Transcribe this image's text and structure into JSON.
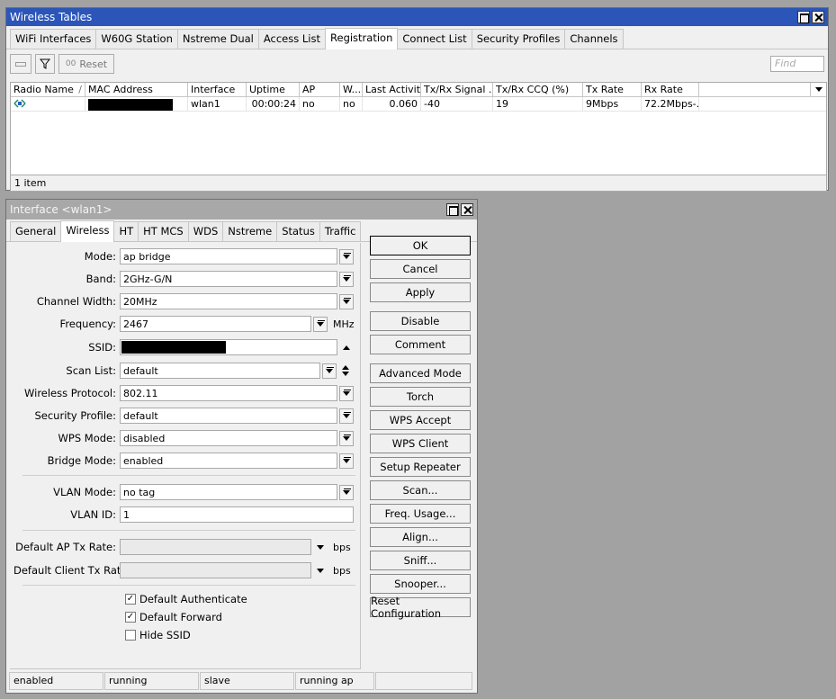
{
  "wt": {
    "title": "Wireless Tables",
    "tabs": [
      "WiFi Interfaces",
      "W60G Station",
      "Nstreme Dual",
      "Access List",
      "Registration",
      "Connect List",
      "Security Profiles",
      "Channels"
    ],
    "reset_label": "Reset",
    "find_placeholder": "Find",
    "columns": [
      "Radio Name",
      "MAC Address",
      "Interface",
      "Uptime",
      "AP",
      "W...",
      "Last Activit...",
      "Tx/Rx Signal ...",
      "Tx/Rx CCQ (%)",
      "Tx Rate",
      "Rx Rate"
    ],
    "row": {
      "interface": "wlan1",
      "uptime": "00:00:24",
      "ap": "no",
      "w": "no",
      "last": "0.060",
      "signal": "-40",
      "ccq": "19",
      "tx": "9Mbps",
      "rx": "72.2Mbps-..."
    },
    "count": "1 item"
  },
  "iw": {
    "title": "Interface <wlan1>",
    "tabs": [
      "General",
      "Wireless",
      "HT",
      "HT MCS",
      "WDS",
      "Nstreme",
      "Status",
      "Traffic"
    ],
    "labels": {
      "mode": "Mode:",
      "band": "Band:",
      "chw": "Channel Width:",
      "freq": "Frequency:",
      "ssid": "SSID:",
      "scan": "Scan List:",
      "proto": "Wireless Protocol:",
      "sec": "Security Profile:",
      "wps": "WPS Mode:",
      "bridge": "Bridge Mode:",
      "vlanmode": "VLAN Mode:",
      "vlanid": "VLAN ID:",
      "aptx": "Default AP Tx Rate:",
      "cltx": "Default Client Tx Rate:"
    },
    "values": {
      "mode": "ap bridge",
      "band": "2GHz-G/N",
      "chw": "20MHz",
      "freq": "2467",
      "scan": "default",
      "proto": "802.11",
      "sec": "default",
      "wps": "disabled",
      "bridge": "enabled",
      "vlanmode": "no tag",
      "vlanid": "1"
    },
    "units": {
      "mhz": "MHz",
      "bps": "bps"
    },
    "checks": {
      "auth": "Default Authenticate",
      "fwd": "Default Forward",
      "hide": "Hide SSID"
    },
    "buttons": [
      "OK",
      "Cancel",
      "Apply",
      "Disable",
      "Comment",
      "Advanced Mode",
      "Torch",
      "WPS Accept",
      "WPS Client",
      "Setup Repeater",
      "Scan...",
      "Freq. Usage...",
      "Align...",
      "Sniff...",
      "Snooper...",
      "Reset Configuration"
    ],
    "status": [
      "enabled",
      "running",
      "slave",
      "running ap"
    ]
  }
}
